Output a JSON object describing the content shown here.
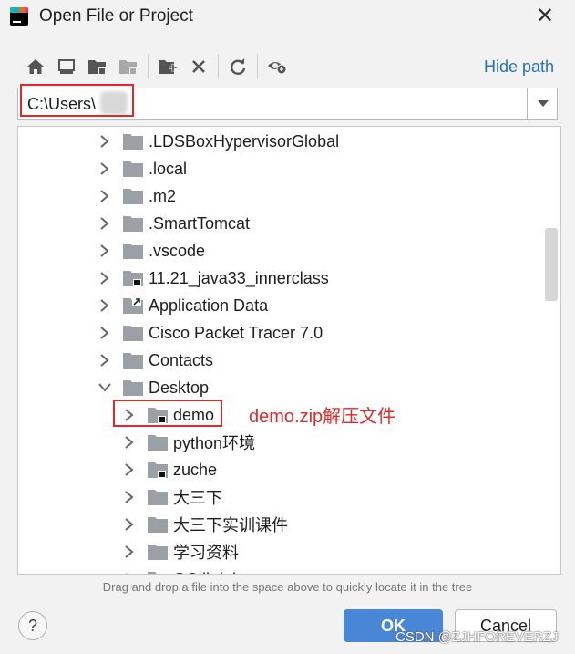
{
  "window": {
    "title": "Open File or Project"
  },
  "toolbar": {
    "icons": [
      "home-icon",
      "desktop-icon",
      "project-folder-icon",
      "module-folder-icon",
      "new-folder-icon",
      "delete-icon",
      "refresh-icon",
      "show-hidden-icon"
    ],
    "hide_path_label": "Hide path"
  },
  "path": {
    "value": "C:\\Users\\"
  },
  "tree": {
    "items": [
      {
        "label": ".LDSBoxHypervisorGlobal",
        "expanded": false,
        "marker": ""
      },
      {
        "label": ".local",
        "expanded": false,
        "marker": ""
      },
      {
        "label": ".m2",
        "expanded": false,
        "marker": ""
      },
      {
        "label": ".SmartTomcat",
        "expanded": false,
        "marker": ""
      },
      {
        "label": ".vscode",
        "expanded": false,
        "marker": ""
      },
      {
        "label": "11.21_java33_innerclass",
        "expanded": false,
        "marker": "project"
      },
      {
        "label": "Application Data",
        "expanded": false,
        "marker": "link"
      },
      {
        "label": "Cisco Packet Tracer 7.0",
        "expanded": false,
        "marker": ""
      },
      {
        "label": "Contacts",
        "expanded": false,
        "marker": ""
      },
      {
        "label": "Desktop",
        "expanded": true,
        "marker": ""
      },
      {
        "label": "demo",
        "expanded": false,
        "marker": "project"
      },
      {
        "label": "python环境",
        "expanded": false,
        "marker": ""
      },
      {
        "label": "zuche",
        "expanded": false,
        "marker": "project"
      },
      {
        "label": "大三下",
        "expanded": false,
        "marker": ""
      },
      {
        "label": "大三下实训课件",
        "expanded": false,
        "marker": ""
      },
      {
        "label": "学习资料",
        "expanded": false,
        "marker": ""
      },
      {
        "label": "GCtlkdnl",
        "expanded": false,
        "marker": ""
      }
    ]
  },
  "annotation": {
    "text": "demo.zip解压文件",
    "color": "#e02a2a"
  },
  "hint": "Drag and drop a file into the space above to quickly locate it in the tree",
  "buttons": {
    "ok": "OK",
    "cancel": "Cancel",
    "help": "?"
  },
  "watermark": "CSDN @ZJHFOREVERZJ",
  "colors": {
    "accent": "#4a86d6",
    "link": "#2470b3",
    "folder": "#9aa0a6",
    "highlight": "#e02a2a"
  }
}
